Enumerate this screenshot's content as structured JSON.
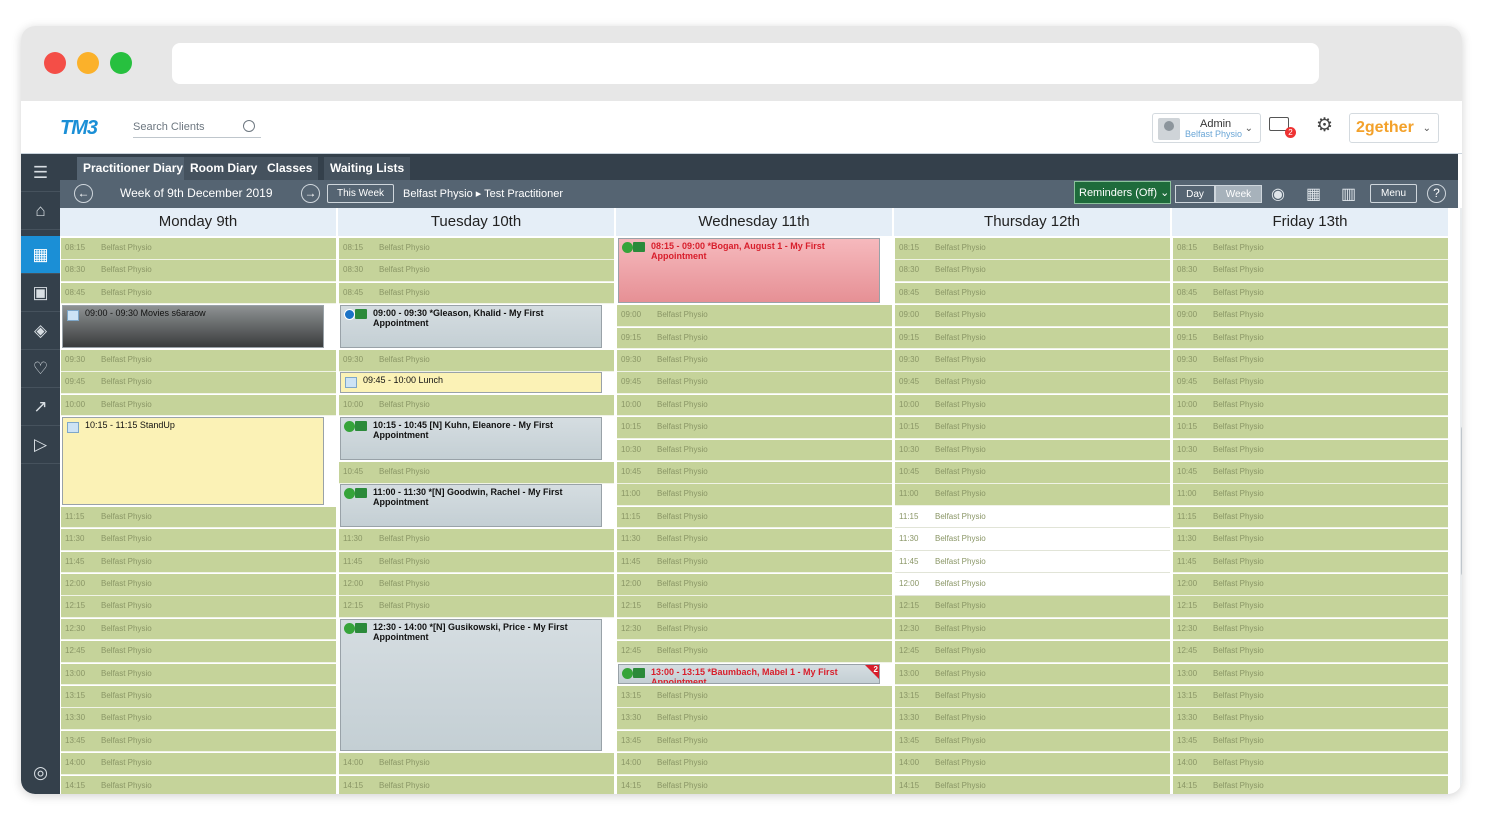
{
  "header": {
    "logo": "TM3",
    "search_placeholder": "Search Clients",
    "user_name": "Admin",
    "user_location": "Belfast Physio",
    "mail_badge": "2",
    "brand": "2gether"
  },
  "tabs": [
    {
      "label": "Practitioner Diary"
    },
    {
      "label": "Room Diary"
    },
    {
      "label": "Classes"
    },
    {
      "label": "Waiting Lists"
    }
  ],
  "nav": {
    "week_label": "Week of 9th December 2019",
    "this_week": "This Week",
    "practitioner_path": "Belfast Physio ▸ Test Practitioner",
    "reminders": "Reminders (Off)",
    "day": "Day",
    "week": "Week",
    "menu": "Menu"
  },
  "days": [
    {
      "label": "Monday 9th"
    },
    {
      "label": "Tuesday 10th"
    },
    {
      "label": "Wednesday 11th"
    },
    {
      "label": "Thursday 12th"
    },
    {
      "label": "Friday 13th"
    }
  ],
  "location": "Belfast Physio",
  "times": [
    "08:15",
    "08:30",
    "08:45",
    "09:00",
    "09:15",
    "09:30",
    "09:45",
    "10:00",
    "10:15",
    "10:30",
    "10:45",
    "11:00",
    "11:15",
    "11:30",
    "11:45",
    "12:00",
    "12:15",
    "12:30",
    "12:45",
    "13:00",
    "13:15",
    "13:30",
    "13:45",
    "14:00",
    "14:15"
  ],
  "appointments": {
    "mon_movies": "09:00 - 09:30  Movies s6araow",
    "mon_standup": "10:15 - 11:15  StandUp",
    "tue_gleason": "09:00 - 09:30  *Gleason, Khalid - My First Appointment",
    "tue_lunch": "09:45 - 10:00  Lunch",
    "tue_kuhn": "10:15 - 10:45  [N] Kuhn, Eleanore - My First Appointment",
    "tue_goodwin": "11:00 - 11:30  *[N] Goodwin, Rachel - My First Appointment",
    "tue_gusikowski": "12:30 - 14:00  *[N] Gusikowski, Price - My First Appointment",
    "wed_bogan": "08:15 - 09:00  *Bogan, August 1 - My First Appointment",
    "wed_baumbach": "13:00 - 13:15  *Baumbach, Mabel 1 - My First Appointment",
    "wed_baumbach_flag": "2"
  },
  "colors": {
    "slot_green": "#c5d39a",
    "accent_blue": "#1b8fd6",
    "brand_orange": "#f3a12a",
    "sidebar": "#34404b"
  }
}
